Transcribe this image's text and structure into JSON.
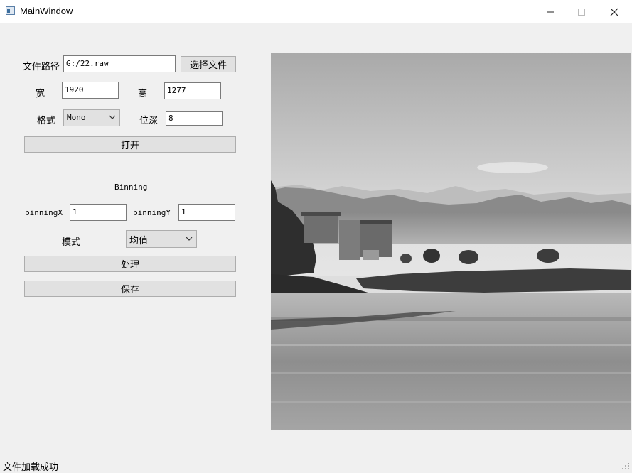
{
  "window": {
    "title": "MainWindow"
  },
  "form": {
    "file_path_label": "文件路径",
    "file_path_value": "G:/22.raw",
    "choose_file_button": "选择文件",
    "width_label": "宽",
    "width_value": "1920",
    "height_label": "高",
    "height_value": "1277",
    "format_label": "格式",
    "format_value": "Mono",
    "bitdepth_label": "位深",
    "bitdepth_value": "8",
    "open_button": "打开"
  },
  "binning": {
    "heading": "Binning",
    "x_label": "binningX",
    "x_value": "1",
    "y_label": "binningY",
    "y_value": "1",
    "mode_label": "模式",
    "mode_value": "均值",
    "process_button": "处理",
    "save_button": "保存"
  },
  "status_bar": {
    "message": "文件加载成功"
  },
  "icons": [
    "app-icon",
    "minimize-icon",
    "maximize-icon",
    "close-icon",
    "chevron-down-icon",
    "size-grip-icon"
  ]
}
